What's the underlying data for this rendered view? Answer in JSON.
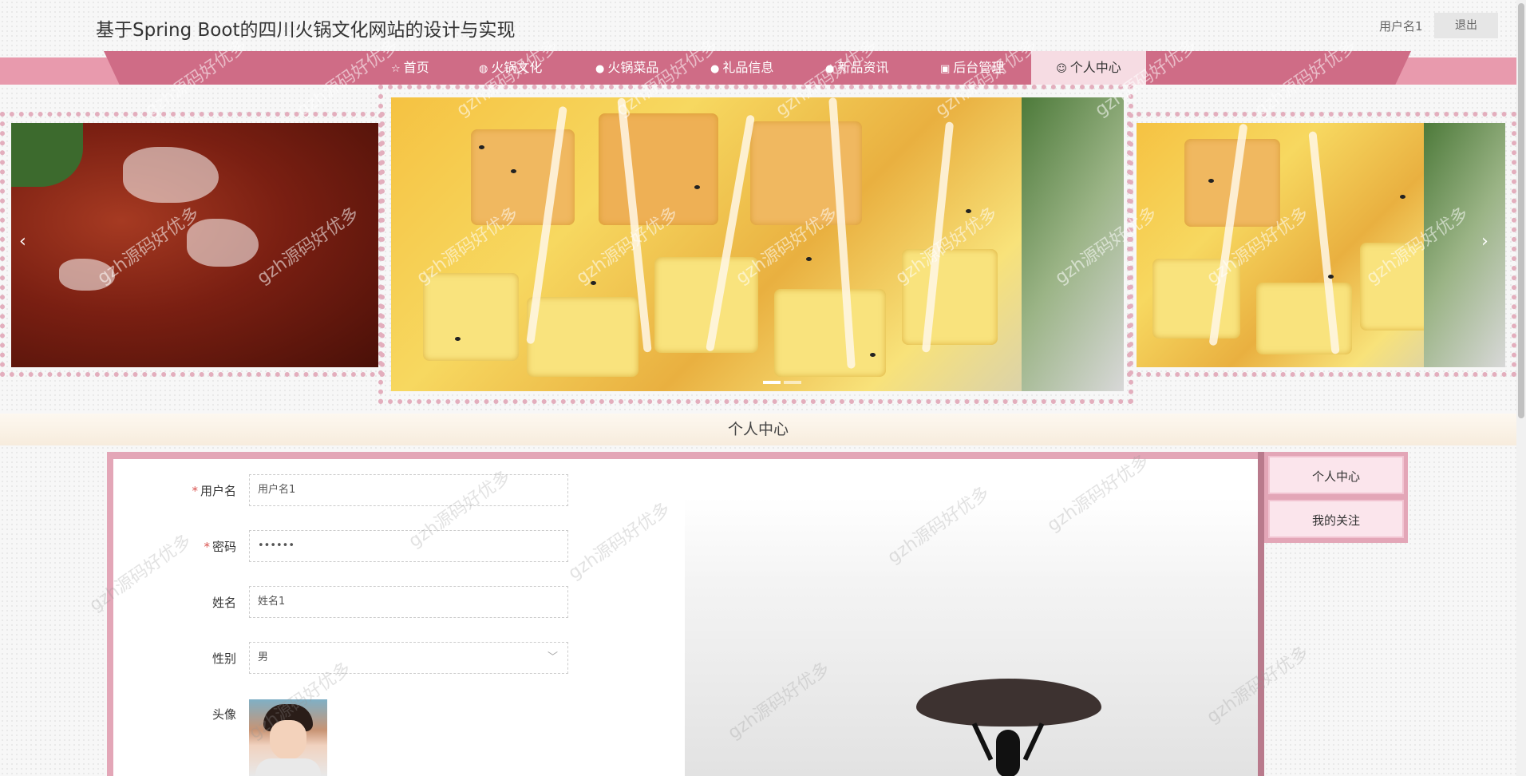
{
  "header": {
    "site_title": "基于Spring Boot的四川火锅文化网站的设计与实现",
    "user_name": "用户名1",
    "logout_label": "退出"
  },
  "nav": {
    "items": [
      {
        "label": "首页",
        "icon": "star-icon"
      },
      {
        "label": "火锅文化",
        "icon": "culture-icon"
      },
      {
        "label": "火锅菜品",
        "icon": "info-icon"
      },
      {
        "label": "礼品信息",
        "icon": "question-icon"
      },
      {
        "label": "新品资讯",
        "icon": "info-icon"
      },
      {
        "label": "后台管理",
        "icon": "admin-icon"
      },
      {
        "label": "个人中心",
        "icon": "user-icon"
      }
    ],
    "active_index": 6
  },
  "banner": {
    "prev_arrow": "‹",
    "next_arrow": "›",
    "indicator_count": 2,
    "active_indicator": 0
  },
  "section": {
    "title": "个人中心"
  },
  "form": {
    "username_label": "用户名",
    "username_value": "用户名1",
    "password_label": "密码",
    "password_value": "••••••",
    "name_label": "姓名",
    "name_value": "姓名1",
    "gender_label": "性别",
    "gender_value": "男",
    "avatar_label": "头像"
  },
  "side_menu": {
    "items": [
      "个人中心",
      "我的关注"
    ]
  },
  "watermark_text": "gzh源码好优多",
  "colors": {
    "accent": "#cf6c86",
    "nav_band": "#e89aad",
    "panel_border": "#e3a6b7",
    "required_mark": "#d9534f"
  }
}
